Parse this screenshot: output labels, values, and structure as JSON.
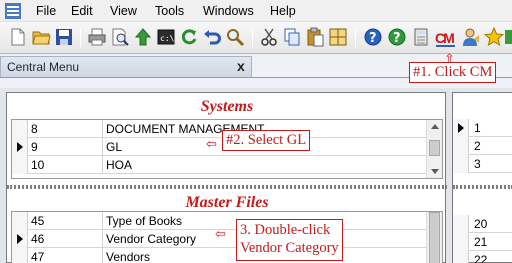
{
  "menu": [
    "File",
    "Edit",
    "View",
    "Tools",
    "Windows",
    "Help"
  ],
  "toolbar": {
    "icons": [
      "new-document-icon",
      "open-folder-icon",
      "save-icon",
      "print-icon",
      "print-preview-icon",
      "green-up-arrow-icon",
      "console-icon",
      "refresh-icon",
      "undo-icon",
      "find-icon",
      "cut-icon",
      "copy-icon",
      "paste-icon",
      "grid-icon",
      "help-icon",
      "green-help-icon",
      "calculator-icon",
      "central-menu-icon",
      "user-icon",
      "favorite-star-icon"
    ],
    "cm_label": "CM",
    "accent": "#c41a1a"
  },
  "tab": {
    "label": "Central Menu",
    "close": "x"
  },
  "systems": {
    "title": "Systems",
    "rows": [
      {
        "id": "8",
        "name": "DOCUMENT MANAGEMENT"
      },
      {
        "id": "9",
        "name": "GL"
      },
      {
        "id": "10",
        "name": "HOA"
      }
    ]
  },
  "master_files": {
    "title": "Master Files",
    "rows": [
      {
        "id": "45",
        "name": "Type of Books"
      },
      {
        "id": "46",
        "name": "Vendor Category"
      },
      {
        "id": "47",
        "name": "Vendors"
      }
    ]
  },
  "right_top": [
    "1",
    "2",
    "3"
  ],
  "right_bottom": [
    "20",
    "21",
    "22"
  ],
  "annotations": {
    "step1": "#1. Click CM",
    "step2": "#2. Select GL",
    "step3_line1": "3. Double-click",
    "step3_line2": "Vendor Category"
  }
}
